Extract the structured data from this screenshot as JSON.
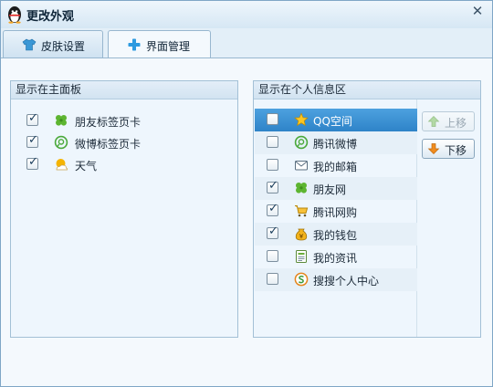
{
  "window": {
    "title": "更改外观",
    "logo_icon": "qq-penguin-icon",
    "close_glyph": "✕"
  },
  "tabs": [
    {
      "label": "皮肤设置",
      "icon": "tshirt-icon",
      "active": false
    },
    {
      "label": "界面管理",
      "icon": "plus-icon",
      "active": true
    }
  ],
  "main_panel": {
    "header": "显示在主面板",
    "items": [
      {
        "label": "朋友标签页卡",
        "checked": true,
        "icon": "clover-icon"
      },
      {
        "label": "微博标签页卡",
        "checked": true,
        "icon": "weibo-icon"
      },
      {
        "label": "天气",
        "checked": true,
        "icon": "weather-icon"
      }
    ]
  },
  "info_panel": {
    "header": "显示在个人信息区",
    "items": [
      {
        "label": "QQ空间",
        "checked": false,
        "selected": true,
        "icon": "star-icon"
      },
      {
        "label": "腾讯微博",
        "checked": false,
        "icon": "weibo-icon"
      },
      {
        "label": "我的邮箱",
        "checked": false,
        "icon": "mail-icon"
      },
      {
        "label": "朋友网",
        "checked": true,
        "icon": "clover-icon"
      },
      {
        "label": "腾讯网购",
        "checked": true,
        "icon": "cart-icon"
      },
      {
        "label": "我的钱包",
        "checked": true,
        "icon": "wallet-icon"
      },
      {
        "label": "我的资讯",
        "checked": false,
        "icon": "news-icon"
      },
      {
        "label": "搜搜个人中心",
        "checked": false,
        "icon": "soso-icon"
      }
    ],
    "move_up_label": "上移",
    "move_down_label": "下移",
    "move_up_enabled": false
  },
  "checkmark_glyph": "✓",
  "colors": {
    "selected_row": "#3a8fd4",
    "window_bg": "#e3eff8",
    "panel_bg": "#eef6fd"
  }
}
